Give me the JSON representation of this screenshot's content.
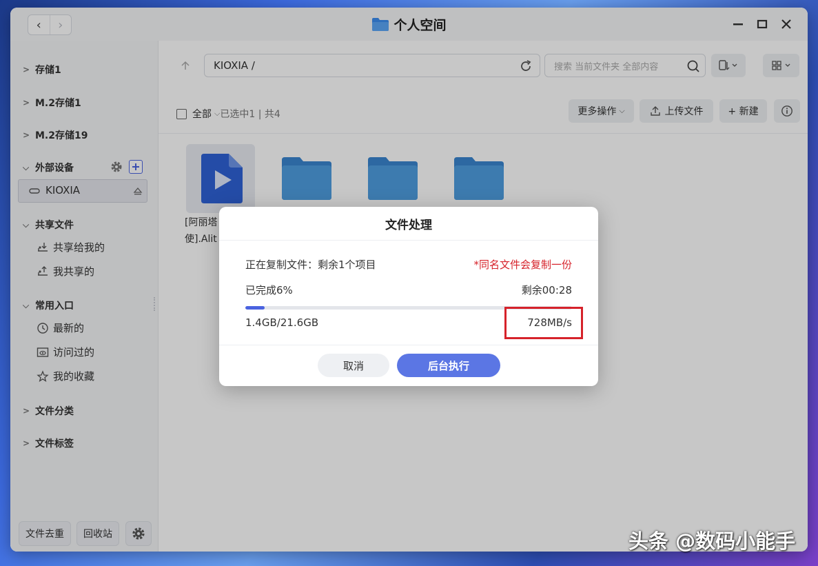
{
  "window": {
    "title": "个人空间",
    "nav": {
      "back": "‹",
      "forward": "›"
    }
  },
  "sidebar": {
    "sections": [
      {
        "label": "存储1",
        "expanded": false
      },
      {
        "label": "M.2存储1",
        "expanded": false
      },
      {
        "label": "M.2存储19",
        "expanded": false
      },
      {
        "label": "外部设备",
        "expanded": true
      },
      {
        "label": "共享文件",
        "expanded": true
      },
      {
        "label": "常用入口",
        "expanded": true
      },
      {
        "label": "文件分类",
        "expanded": false
      },
      {
        "label": "文件标签",
        "expanded": false
      }
    ],
    "devices": [
      {
        "label": "KIOXIA"
      }
    ],
    "shared": [
      {
        "label": "共享给我的"
      },
      {
        "label": "我共享的"
      }
    ],
    "common": [
      {
        "label": "最新的"
      },
      {
        "label": "访问过的"
      },
      {
        "label": "我的收藏"
      }
    ],
    "bottom": {
      "dedupe": "文件去重",
      "recycle": "回收站"
    }
  },
  "toolbar": {
    "path": "KIOXIA /",
    "search_placeholder": "搜索 当前文件夹 全部内容",
    "select_all": "全部",
    "selection_info": "已选中1 | 共4",
    "more_actions": "更多操作",
    "upload": "上传文件",
    "new": "+ 新建"
  },
  "files": [
    {
      "name": "[阿丽塔",
      "name2": "使].Alit",
      "type": "video",
      "selected": true
    },
    {
      "type": "folder"
    },
    {
      "type": "folder"
    },
    {
      "type": "folder"
    }
  ],
  "dialog": {
    "title": "文件处理",
    "status": "正在复制文件：剩余1个项目",
    "note": "*同名文件会复制一份",
    "completed": "已完成6%",
    "remaining_time": "剩余00:28",
    "progress_percent": 6,
    "size": "1.4GB/21.6GB",
    "speed": "728MB/s",
    "cancel": "取消",
    "background": "后台执行"
  },
  "watermark": "头条 @数码小能手",
  "colors": {
    "accent": "#4a63e0",
    "note_red": "#d6222a",
    "folder": "#4a9be0",
    "video": "#2f62d6"
  }
}
